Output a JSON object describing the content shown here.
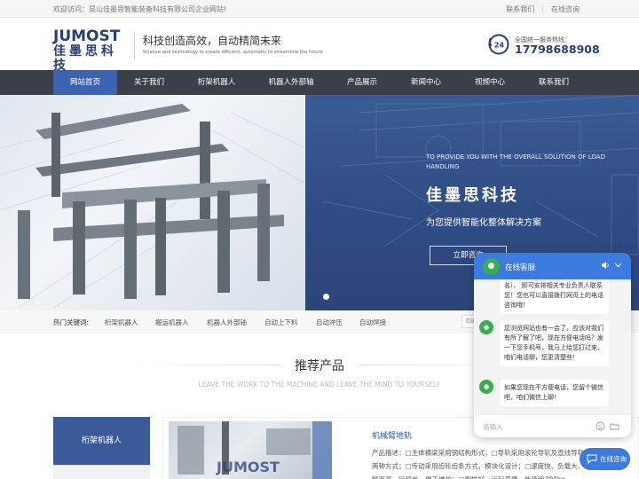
{
  "topbar": {
    "welcome": "欢迎访问：昆山佳墨思智能装备科技有限公司企业网站!",
    "contact_link": "联系我们",
    "consult_link": "在线咨询",
    "separator": "|"
  },
  "header": {
    "logo_en": "JUMOST",
    "logo_cn": "佳墨思科技",
    "slogan": "科技创造高效，自动精简未来",
    "slogan_en": "Science and technology to create efficient, automatic to streamline the future",
    "hotline_badge": "24",
    "hotline_label": "全国统一服务热线：",
    "hotline_number": "17798688908"
  },
  "nav": {
    "items": [
      {
        "label": "网站首页",
        "active": true
      },
      {
        "label": "关于我们"
      },
      {
        "label": "桁架机器人"
      },
      {
        "label": "机器人外部轴"
      },
      {
        "label": "产品展示"
      },
      {
        "label": "新闻中心"
      },
      {
        "label": "视频中心"
      },
      {
        "label": "联系我们"
      }
    ]
  },
  "banner": {
    "en_text": "TO PROVIDE YOU WITH THE OVERALL SOLUTION OF LOAD HANDLING",
    "brand": "佳墨思科技",
    "cn_text": "为您提供智能化整体解决方案",
    "button": "立即咨询"
  },
  "keywords": {
    "label": "热门关键词:",
    "items": [
      "桁架机器人",
      "搬运机器人",
      "机器人外部轴",
      "自动上下料",
      "自动冲压",
      "自动焊接"
    ],
    "search_placeholder": "请输"
  },
  "recommend": {
    "title": "推荐产品",
    "subtitle": "LEAVE THE WORK TO THE MACHINE AND LEAVE THE MIND TO YOURSELF",
    "category": "桁架机器人",
    "product_name": "机械臂地轨",
    "product_watermark": "JUMOST",
    "product_desc": "产品描述：□主体横梁采用钢结构形式；□导轨采用滚轮导轨及直线导轨两种方式；□传动采用齿轮齿条方式，模块化设计；□速度快、负载大、精度高、行程长、便于维护；□刚性好、运行平稳、能承受300kg"
  },
  "chat": {
    "title": "在线客服",
    "avatar_glyph": "●",
    "messages": [
      "名）、 即可安排相关专业负责人联系您！您也可以直接拨打网页上的电话咨询哦！",
      "您浏览网站也有一会了，应该对我们有所了解了吧，现在方便电话吗？发一下您手机号，我马上给您打过来，咱们电话聊，您更清楚些！",
      "如果您现在不方便电话，您留个微信吧，咱们微信上聊！"
    ],
    "input_placeholder": "请输入",
    "online_button": "在线咨询"
  },
  "colors": {
    "brand_blue": "#2a3f78",
    "nav_bg": "#3a3f4a",
    "nav_active": "#3b63b2",
    "chat_blue": "#3b7be0",
    "wechat_green": "#36b04a"
  }
}
